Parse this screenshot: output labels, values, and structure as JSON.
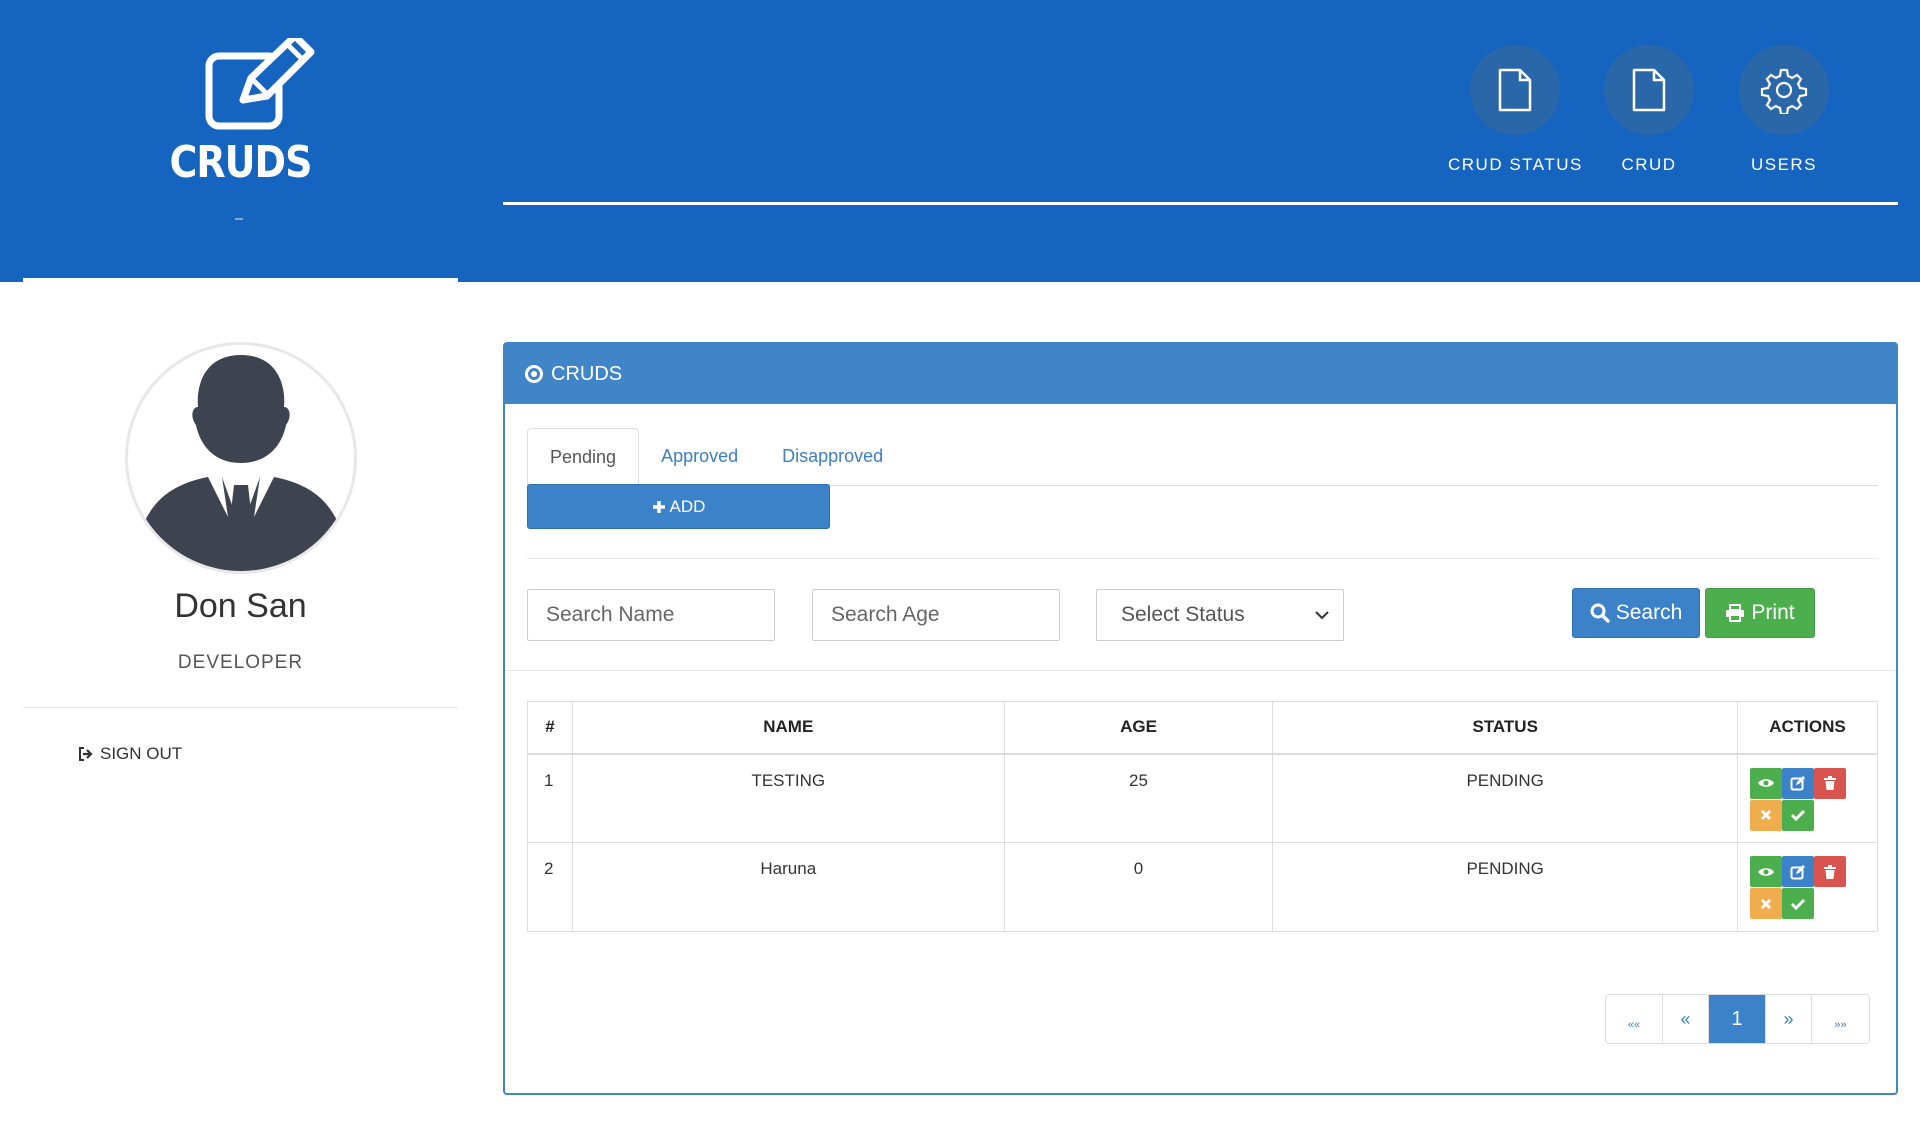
{
  "app": {
    "logo_text": "CRUDS"
  },
  "nav": [
    {
      "label": "CRUD STATUS",
      "icon": "file-icon"
    },
    {
      "label": "CRUD",
      "icon": "file-icon"
    },
    {
      "label": "USERS",
      "icon": "gear-icon"
    }
  ],
  "user": {
    "name": "Don San",
    "role": "DEVELOPER",
    "signout": "SIGN OUT"
  },
  "panel": {
    "title": "CRUDS",
    "tabs": [
      "Pending",
      "Approved",
      "Disapproved"
    ],
    "active_tab": "Pending",
    "add_label": "ADD"
  },
  "filters": {
    "name_placeholder": "Search Name",
    "age_placeholder": "Search Age",
    "status_selected": "Select Status",
    "search_label": "Search",
    "print_label": "Print"
  },
  "table": {
    "headers": [
      "#",
      "NAME",
      "AGE",
      "STATUS",
      "ACTIONS"
    ],
    "rows": [
      {
        "num": "1",
        "name": "TESTING",
        "age": "25",
        "status": "PENDING"
      },
      {
        "num": "2",
        "name": "Haruna",
        "age": "0",
        "status": "PENDING"
      }
    ]
  },
  "pagination": {
    "first": "««",
    "prev": "«",
    "current": "1",
    "next": "»",
    "last": "»»"
  },
  "colors": {
    "header": "#1565c0",
    "panel": "#3f85c8",
    "primary": "#3b82c9",
    "success": "#4cae4c",
    "danger": "#d9534f",
    "warning": "#f0ad4e"
  }
}
